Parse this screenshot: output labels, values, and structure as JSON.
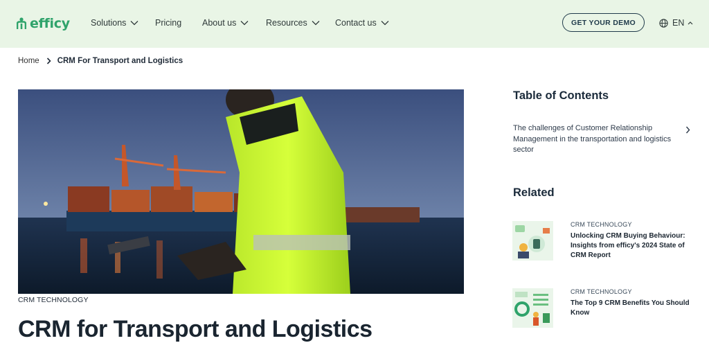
{
  "header": {
    "logo_text": "efficy",
    "nav": [
      {
        "label": "Solutions",
        "has_dropdown": true
      },
      {
        "label": "Pricing",
        "has_dropdown": false
      },
      {
        "label": "About us",
        "has_dropdown": true
      },
      {
        "label": "Resources",
        "has_dropdown": true
      },
      {
        "label": "Contact us",
        "has_dropdown": true
      }
    ],
    "cta_label": "GET YOUR DEMO",
    "language": "EN",
    "colors": {
      "background": "#e9f5e6",
      "brand": "#2fa36b"
    }
  },
  "breadcrumb": {
    "home": "Home",
    "current": "CRM For Transport and Logistics"
  },
  "article": {
    "category": "CRM TECHNOLOGY",
    "title": "CRM for Transport and Logistics"
  },
  "sidebar": {
    "toc_title": "Table of Contents",
    "toc_items": [
      {
        "label": "The challenges of Customer Relationship Management in the transportation and logistics sector"
      }
    ],
    "related_title": "Related",
    "related": [
      {
        "category": "CRM TECHNOLOGY",
        "title": "Unlocking CRM Buying Behaviour: Insights from efficy's 2024 State of CRM Report"
      },
      {
        "category": "CRM TECHNOLOGY",
        "title": "The Top 9 CRM Benefits You Should Know"
      }
    ]
  }
}
